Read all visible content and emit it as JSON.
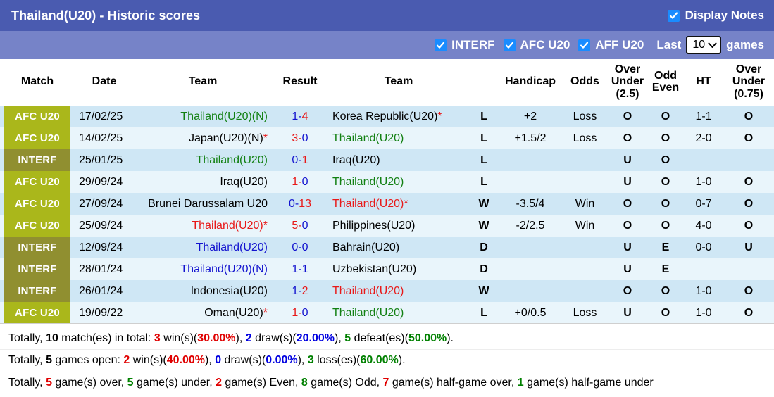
{
  "header": {
    "title": "Thailand(U20) - Historic scores",
    "display_notes_label": "Display Notes",
    "display_notes_checked": true,
    "filters": [
      {
        "label": "INTERF",
        "checked": true
      },
      {
        "label": "AFC U20",
        "checked": true
      },
      {
        "label": "AFF U20",
        "checked": true
      }
    ],
    "last_label": "Last",
    "last_value": "10",
    "games_label": "games"
  },
  "columns": [
    {
      "key": "match",
      "label": "Match"
    },
    {
      "key": "date",
      "label": "Date"
    },
    {
      "key": "team1",
      "label": "Team"
    },
    {
      "key": "result",
      "label": "Result"
    },
    {
      "key": "team2",
      "label": "Team"
    },
    {
      "key": "wl",
      "label": ""
    },
    {
      "key": "hcap",
      "label": "Handicap"
    },
    {
      "key": "odds",
      "label": "Odds"
    },
    {
      "key": "ou25",
      "label": "Over Under (2.5)",
      "lines": [
        "Over",
        "Under",
        "(2.5)"
      ]
    },
    {
      "key": "oe",
      "label": "Odd Even",
      "lines": [
        "Odd",
        "Even"
      ]
    },
    {
      "key": "ht",
      "label": "HT"
    },
    {
      "key": "ou075",
      "label": "Over Under (0.75)",
      "lines": [
        "Over",
        "Under",
        "(0.75)"
      ]
    }
  ],
  "rows": [
    {
      "match": "AFC U20",
      "match_type": "afc",
      "date": "17/02/25",
      "team1": "Thailand(U20)(N)",
      "team1_color": "green",
      "team1_star": false,
      "score_home": "1",
      "score_home_color": "blue",
      "score_away": "4",
      "score_away_color": "red",
      "team2": "Korea Republic(U20)",
      "team2_color": "black",
      "team2_star": true,
      "wl": "L",
      "wl_color": "green",
      "handicap": "+2",
      "handicap_color": "blue",
      "odds": "Loss",
      "odds_color": "green",
      "ou25": "O",
      "oe": "O",
      "ht": "1-1",
      "ou075": "O"
    },
    {
      "match": "AFC U20",
      "match_type": "afc",
      "date": "14/02/25",
      "team1": "Japan(U20)(N)",
      "team1_color": "black",
      "team1_star": true,
      "score_home": "3",
      "score_home_color": "red",
      "score_away": "0",
      "score_away_color": "blue",
      "team2": "Thailand(U20)",
      "team2_color": "green",
      "team2_star": false,
      "wl": "L",
      "wl_color": "green",
      "handicap": "+1.5/2",
      "handicap_color": "blue",
      "odds": "Loss",
      "odds_color": "green",
      "ou25": "O",
      "oe": "O",
      "ht": "2-0",
      "ou075": "O"
    },
    {
      "match": "INTERF",
      "match_type": "interf",
      "date": "25/01/25",
      "team1": "Thailand(U20)",
      "team1_color": "green",
      "team1_star": false,
      "score_home": "0",
      "score_home_color": "blue",
      "score_away": "1",
      "score_away_color": "red",
      "team2": "Iraq(U20)",
      "team2_color": "black",
      "team2_star": false,
      "wl": "L",
      "wl_color": "green",
      "handicap": "",
      "handicap_color": "blue",
      "odds": "",
      "odds_color": "green",
      "ou25": "U",
      "oe": "O",
      "ht": "",
      "ou075": ""
    },
    {
      "match": "AFC U20",
      "match_type": "afc",
      "date": "29/09/24",
      "team1": "Iraq(U20)",
      "team1_color": "black",
      "team1_star": false,
      "score_home": "1",
      "score_home_color": "red",
      "score_away": "0",
      "score_away_color": "blue",
      "team2": "Thailand(U20)",
      "team2_color": "green",
      "team2_star": false,
      "wl": "L",
      "wl_color": "green",
      "handicap": "",
      "handicap_color": "blue",
      "odds": "",
      "odds_color": "green",
      "ou25": "U",
      "oe": "O",
      "ht": "1-0",
      "ou075": "O"
    },
    {
      "match": "AFC U20",
      "match_type": "afc",
      "date": "27/09/24",
      "team1": "Brunei Darussalam U20",
      "team1_color": "black",
      "team1_star": false,
      "score_home": "0",
      "score_home_color": "blue",
      "score_away": "13",
      "score_away_color": "red",
      "team2": "Thailand(U20)",
      "team2_color": "red",
      "team2_star": true,
      "wl": "W",
      "wl_color": "red",
      "handicap": "-3.5/4",
      "handicap_color": "blue",
      "odds": "Win",
      "odds_color": "red",
      "ou25": "O",
      "oe": "O",
      "ht": "0-7",
      "ou075": "O"
    },
    {
      "match": "AFC U20",
      "match_type": "afc",
      "date": "25/09/24",
      "team1": "Thailand(U20)",
      "team1_color": "red",
      "team1_star": true,
      "score_home": "5",
      "score_home_color": "red",
      "score_away": "0",
      "score_away_color": "blue",
      "team2": "Philippines(U20)",
      "team2_color": "black",
      "team2_star": false,
      "wl": "W",
      "wl_color": "red",
      "handicap": "-2/2.5",
      "handicap_color": "blue",
      "odds": "Win",
      "odds_color": "red",
      "ou25": "O",
      "oe": "O",
      "ht": "4-0",
      "ou075": "O"
    },
    {
      "match": "INTERF",
      "match_type": "interf",
      "date": "12/09/24",
      "team1": "Thailand(U20)",
      "team1_color": "blue",
      "team1_star": false,
      "score_home": "0",
      "score_home_color": "blue",
      "score_away": "0",
      "score_away_color": "blue",
      "team2": "Bahrain(U20)",
      "team2_color": "black",
      "team2_star": false,
      "wl": "D",
      "wl_color": "blue",
      "handicap": "",
      "handicap_color": "blue",
      "odds": "",
      "odds_color": "green",
      "ou25": "U",
      "oe": "E",
      "ht": "0-0",
      "ou075": "U"
    },
    {
      "match": "INTERF",
      "match_type": "interf",
      "date": "28/01/24",
      "team1": "Thailand(U20)(N)",
      "team1_color": "blue",
      "team1_star": false,
      "score_home": "1",
      "score_home_color": "blue",
      "score_away": "1",
      "score_away_color": "blue",
      "team2": "Uzbekistan(U20)",
      "team2_color": "black",
      "team2_star": false,
      "wl": "D",
      "wl_color": "blue",
      "handicap": "",
      "handicap_color": "blue",
      "odds": "",
      "odds_color": "green",
      "ou25": "U",
      "oe": "E",
      "ht": "",
      "ou075": ""
    },
    {
      "match": "INTERF",
      "match_type": "interf",
      "date": "26/01/24",
      "team1": "Indonesia(U20)",
      "team1_color": "black",
      "team1_star": false,
      "score_home": "1",
      "score_home_color": "blue",
      "score_away": "2",
      "score_away_color": "red",
      "team2": "Thailand(U20)",
      "team2_color": "red",
      "team2_star": false,
      "wl": "W",
      "wl_color": "red",
      "handicap": "",
      "handicap_color": "blue",
      "odds": "",
      "odds_color": "green",
      "ou25": "O",
      "oe": "O",
      "ht": "1-0",
      "ou075": "O"
    },
    {
      "match": "AFC U20",
      "match_type": "afc",
      "date": "19/09/22",
      "team1": "Oman(U20)",
      "team1_color": "black",
      "team1_star": true,
      "score_home": "1",
      "score_home_color": "red",
      "score_away": "0",
      "score_away_color": "blue",
      "team2": "Thailand(U20)",
      "team2_color": "green",
      "team2_star": false,
      "wl": "L",
      "wl_color": "green",
      "handicap": "+0/0.5",
      "handicap_color": "black",
      "odds": "Loss",
      "odds_color": "green",
      "ou25": "U",
      "oe": "O",
      "ht": "1-0",
      "ou075": "O"
    }
  ],
  "summary": {
    "line1": {
      "t0": "Totally, ",
      "n_total": "10",
      "t1": " match(es) in total: ",
      "n_win": "3",
      "t2": " win(s)(",
      "p_win": "30.00%",
      "t3": "), ",
      "n_draw": "2",
      "t4": " draw(s)(",
      "p_draw": "20.00%",
      "t5": "), ",
      "n_defeat": "5",
      "t6": " defeat(es)(",
      "p_defeat": "50.00%",
      "t7": ")."
    },
    "line2": {
      "t0": "Totally, ",
      "n_open": "5",
      "t1": " games open: ",
      "n_win": "2",
      "t2": " win(s)(",
      "p_win": "40.00%",
      "t3": "), ",
      "n_draw": "0",
      "t4": " draw(s)(",
      "p_draw": "0.00%",
      "t5": "), ",
      "n_loss": "3",
      "t6": " loss(es)(",
      "p_loss": "60.00%",
      "t7": ")."
    },
    "line3": {
      "t0": "Totally, ",
      "n_over": "5",
      "t1": " game(s) over, ",
      "n_under": "5",
      "t2": " game(s) under, ",
      "n_even": "2",
      "t3": " game(s) Even, ",
      "n_odd": "8",
      "t4": " game(s) Odd, ",
      "n_hgover": "7",
      "t5": " game(s) half-game over, ",
      "n_hgunder": "1",
      "t6": " game(s) half-game under"
    }
  },
  "colors": {
    "title_bar": "#4a5bb0",
    "filter_bar": "#7683c8",
    "checkbox": "#1a8cff",
    "badge_afc": "#aab71b",
    "badge_interf": "#908f30",
    "row_odd": "#cfe7f5",
    "row_even": "#e9f5fb",
    "green": "#128012",
    "red": "#e81919",
    "blue": "#1313cf"
  }
}
